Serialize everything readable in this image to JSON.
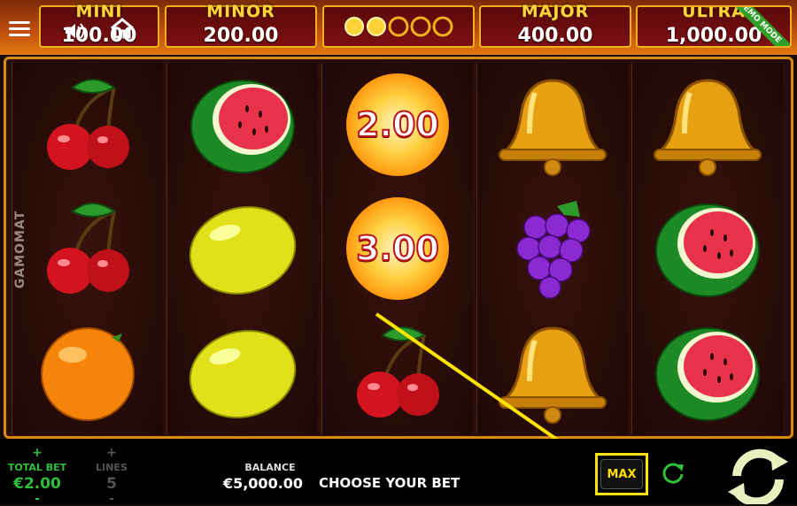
{
  "jackpots": [
    {
      "name": "MINI",
      "value": "100.00"
    },
    {
      "name": "MINOR",
      "value": "200.00"
    },
    {
      "name": "MAJOR",
      "value": "400.00"
    },
    {
      "name": "ULTRA",
      "value": "1,000.00"
    }
  ],
  "jackpot_progress": {
    "filled": 2,
    "total": 5
  },
  "demo_label": "DEMO MODE",
  "brand": "GAMOMAT",
  "reels": [
    [
      "cherry",
      "cherry",
      "orange"
    ],
    [
      "watermelon",
      "lemon",
      "lemon"
    ],
    [
      "coin",
      "coin",
      "cherry"
    ],
    [
      "bell",
      "grapes",
      "bell"
    ],
    [
      "bell",
      "watermelon",
      "watermelon"
    ]
  ],
  "coin_values": [
    "2.00",
    "3.00"
  ],
  "bottom": {
    "total_bet_label": "TOTAL BET",
    "total_bet_value": "€2.00",
    "lines_label": "LINES",
    "lines_value": "5",
    "balance_label": "BALANCE",
    "balance_value": "€5,000.00",
    "message": "CHOOSE YOUR BET",
    "max_label": "MAX",
    "plus": "+",
    "minus": "-"
  },
  "icons": [
    "menu-icon",
    "sound-icon",
    "home-icon",
    "autoplay-icon",
    "spin-icon"
  ],
  "colors": {
    "accent": "#ffe400",
    "gold": "#f0b21a",
    "total_bet": "#2fbf3a"
  }
}
